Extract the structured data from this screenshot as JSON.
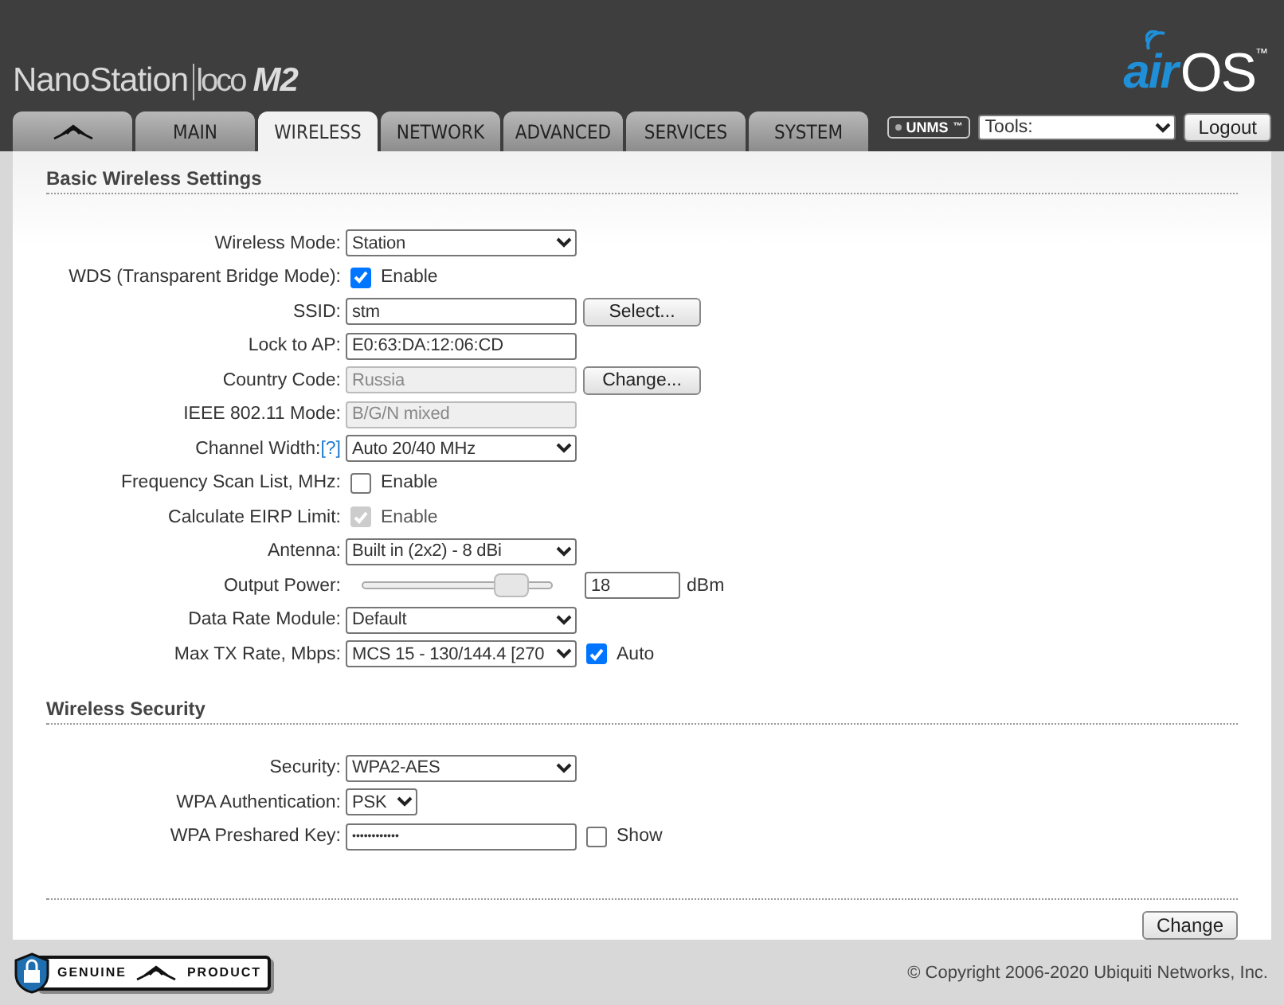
{
  "header": {
    "product": {
      "name": "NanoStation",
      "series": "loco",
      "model": "M2"
    },
    "brand": {
      "prefix": "air",
      "name": "OS",
      "mark": "™"
    }
  },
  "tabs": [
    {
      "kind": "logo",
      "selected": false
    },
    {
      "kind": "text",
      "label": "MAIN",
      "selected": false
    },
    {
      "kind": "text",
      "label": "WIRELESS",
      "selected": true
    },
    {
      "kind": "text",
      "label": "NETWORK",
      "selected": false
    },
    {
      "kind": "text",
      "label": "ADVANCED",
      "selected": false
    },
    {
      "kind": "text",
      "label": "SERVICES",
      "selected": false
    },
    {
      "kind": "text",
      "label": "SYSTEM",
      "selected": false
    }
  ],
  "toolbar": {
    "badge": "UNMS",
    "badge_mark": "™",
    "tools": "Tools:",
    "logout": "Logout"
  },
  "sections": [
    {
      "title": "Basic Wireless Settings",
      "fields": [
        {
          "kind": "select",
          "label": "Wireless Mode:",
          "value": "Station"
        },
        {
          "kind": "checkbox",
          "label": "WDS (Transparent Bridge Mode):",
          "checked": true,
          "disabled": false,
          "text": "Enable"
        },
        {
          "kind": "text",
          "label": "SSID:",
          "value": "stm",
          "disabled": false,
          "button": "Select..."
        },
        {
          "kind": "text",
          "label": "Lock to AP:",
          "value": "E0:63:DA:12:06:CD",
          "disabled": false
        },
        {
          "kind": "text",
          "label": "Country Code:",
          "value": "Russia",
          "disabled": true,
          "button": "Change..."
        },
        {
          "kind": "text",
          "label": "IEEE 802.11 Mode:",
          "value": "B/G/N mixed",
          "disabled": true
        },
        {
          "kind": "select",
          "label": "Channel Width:",
          "help": "[?]",
          "value": "Auto 20/40 MHz"
        },
        {
          "kind": "checkbox",
          "label": "Frequency Scan List, MHz:",
          "checked": false,
          "disabled": false,
          "text": "Enable"
        },
        {
          "kind": "checkbox",
          "label": "Calculate EIRP Limit:",
          "checked": true,
          "disabled": true,
          "text": "Enable"
        },
        {
          "kind": "select",
          "label": "Antenna:",
          "value": "Built in (2x2) - 8 dBi"
        },
        {
          "kind": "slider",
          "label": "Output Power:",
          "level": 0.78,
          "value": "18",
          "unit": "dBm"
        },
        {
          "kind": "select",
          "label": "Data Rate Module:",
          "value": "Default"
        },
        {
          "kind": "select",
          "label": "Max TX Rate, Mbps:",
          "value": "MCS 15 - 130/144.4 [270",
          "checkbox": {
            "checked": true,
            "text": "Auto"
          }
        }
      ]
    },
    {
      "title": "Wireless Security",
      "fields": [
        {
          "kind": "select",
          "label": "Security:",
          "value": "WPA2-AES"
        },
        {
          "kind": "small_select",
          "label": "WPA Authentication:",
          "value": "PSK"
        },
        {
          "kind": "password",
          "label": "WPA Preshared Key:",
          "value": "••••••••••••",
          "checkbox": {
            "checked": false,
            "text": "Show"
          }
        }
      ]
    }
  ],
  "submit": "Change",
  "footer": {
    "badge": [
      "GENUINE",
      "PRODUCT"
    ],
    "copyright": "© Copyright 2006-2020 Ubiquiti Networks, Inc."
  }
}
